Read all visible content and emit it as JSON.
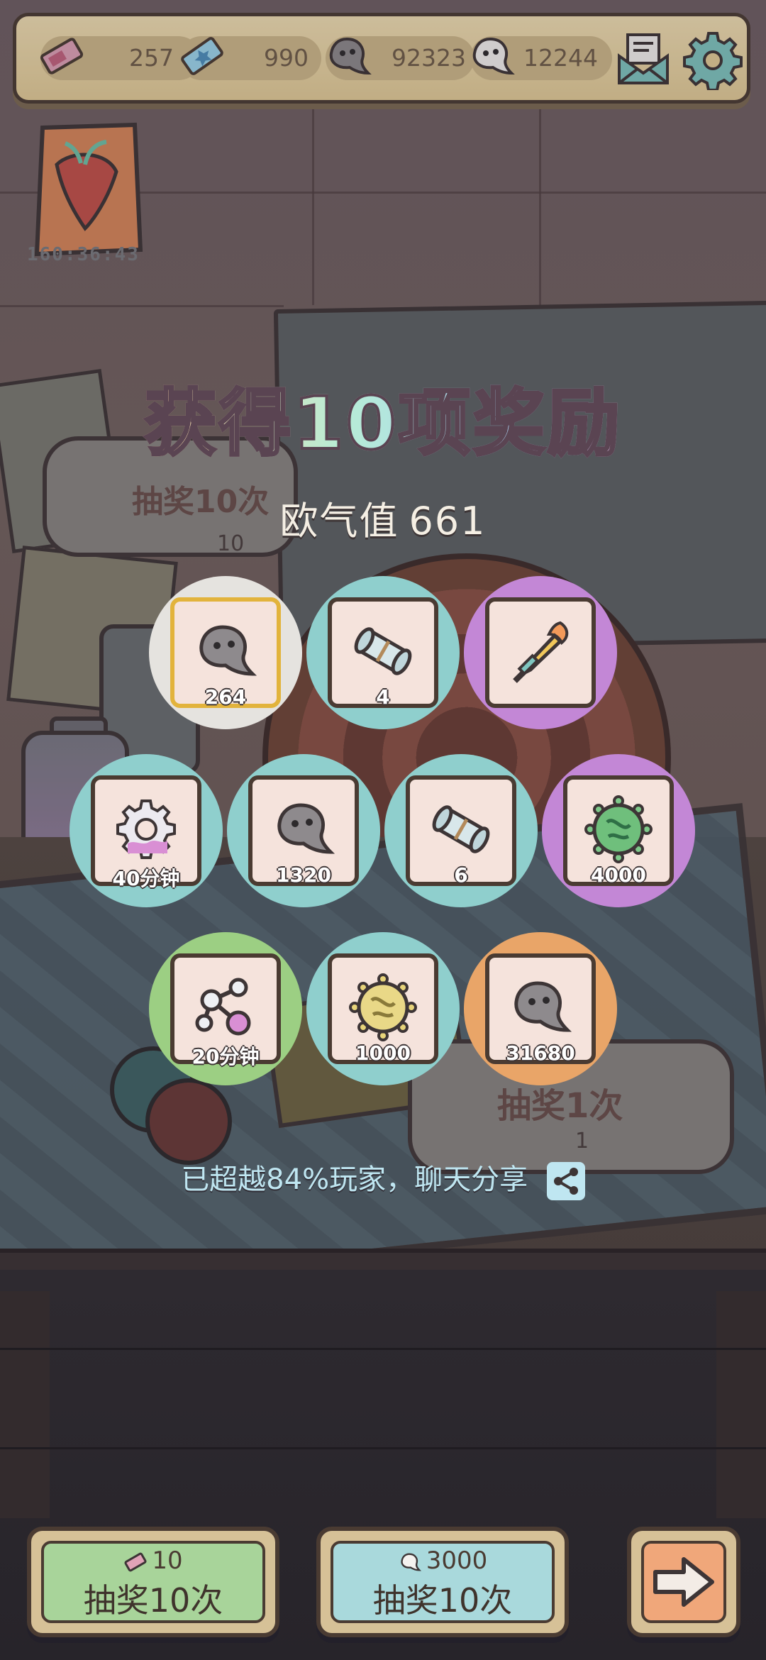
{
  "topbar": {
    "resources": [
      {
        "icon": "ticket-icon",
        "value": "257"
      },
      {
        "icon": "blue-ticket-icon",
        "value": "990"
      },
      {
        "icon": "gray-tadpole-icon",
        "value": "92323"
      },
      {
        "icon": "white-tadpole-icon",
        "value": "12244"
      }
    ],
    "mail_icon": "mail-icon",
    "settings_icon": "gear-icon"
  },
  "event": {
    "timer": "160:36:43"
  },
  "background_panels": {
    "draw10": {
      "title": "抽奖10次",
      "cost": "10"
    },
    "draw1": {
      "title": "抽奖1次",
      "cost": "1"
    }
  },
  "result": {
    "title": "获得10项奖励",
    "luck_label": "欧气值",
    "luck_value": "661",
    "rewards": [
      {
        "item": "gray-tadpole",
        "rarity": "common",
        "qty": "264",
        "bg": "#e5e3df"
      },
      {
        "item": "scroll",
        "rarity": "rare",
        "qty": "4",
        "bg": "#8fcfcd"
      },
      {
        "item": "flame-sword",
        "rarity": "epic",
        "qty": "",
        "bg": "#c387d6"
      },
      {
        "item": "gear-accelerator",
        "rarity": "rare",
        "qty": "40分钟",
        "bg": "#8fcfcd"
      },
      {
        "item": "gray-tadpole",
        "rarity": "rare",
        "qty": "1320",
        "bg": "#8fcfcd"
      },
      {
        "item": "scroll",
        "rarity": "rare",
        "qty": "6",
        "bg": "#8fcfcd"
      },
      {
        "item": "green-virus",
        "rarity": "epic",
        "qty": "4000",
        "bg": "#c387d6"
      },
      {
        "item": "molecule",
        "rarity": "uncommon",
        "qty": "20分钟",
        "bg": "#9ccf83"
      },
      {
        "item": "gold-virus",
        "rarity": "rare",
        "qty": "1000",
        "bg": "#8fcfcd"
      },
      {
        "item": "gray-tadpole",
        "rarity": "legendary",
        "qty": "31680",
        "bg": "#e9a568"
      }
    ],
    "share_text": "已超越84%玩家，聊天分享"
  },
  "buttons": {
    "draw10_ticket": {
      "cost": "10",
      "label": "抽奖10次",
      "color": "#a8d49a"
    },
    "draw10_tadpole": {
      "cost": "3000",
      "label": "抽奖10次",
      "color": "#a9d9dc"
    },
    "next": {
      "icon": "arrow-right-icon",
      "color": "#f0a77a"
    }
  }
}
